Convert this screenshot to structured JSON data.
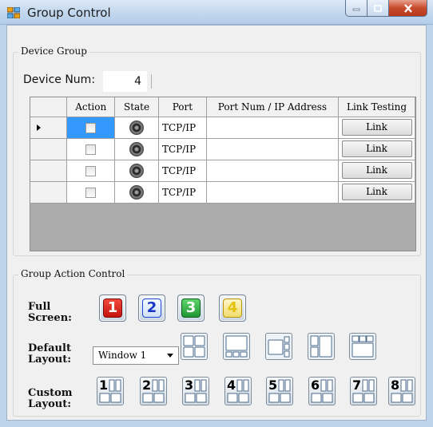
{
  "window": {
    "title": "Group Control"
  },
  "device_group": {
    "title": "Device Group",
    "device_num_label": "Device Num:",
    "device_num_value": "4",
    "columns": [
      "Action",
      "State",
      "Port",
      "Port Num / IP Address",
      "Link Testing"
    ],
    "rows": [
      {
        "action_checked": false,
        "state": "led-off",
        "port": "TCP/IP",
        "address": "",
        "link_label": "Link",
        "selected": true
      },
      {
        "action_checked": false,
        "state": "led-off",
        "port": "TCP/IP",
        "address": "",
        "link_label": "Link",
        "selected": false
      },
      {
        "action_checked": false,
        "state": "led-off",
        "port": "TCP/IP",
        "address": "",
        "link_label": "Link",
        "selected": false
      },
      {
        "action_checked": false,
        "state": "led-off",
        "port": "TCP/IP",
        "address": "",
        "link_label": "Link",
        "selected": false
      }
    ]
  },
  "group_action": {
    "title": "Group Action Control",
    "full_screen": {
      "label_line1": "Full",
      "label_line2": "Screen:",
      "buttons": [
        {
          "label": "1",
          "color": "#e0201c"
        },
        {
          "label": "2",
          "color": "#2046d8"
        },
        {
          "label": "3",
          "color": "#22a83a"
        },
        {
          "label": "4",
          "color": "#f2d21a"
        }
      ]
    },
    "default_layout": {
      "label_line1": "Default",
      "label_line2": "Layout:",
      "select_value": "Window 1",
      "layout_icons": [
        "layout-quad-icon",
        "layout-big-left-icon",
        "layout-big-left-stack-icon",
        "layout-split-icon",
        "layout-grid-top-icon"
      ]
    },
    "custom_layout": {
      "label_line1": "Custom",
      "label_line2": "Layout:",
      "buttons": [
        "1",
        "2",
        "3",
        "4",
        "5",
        "6",
        "7",
        "8"
      ]
    }
  }
}
